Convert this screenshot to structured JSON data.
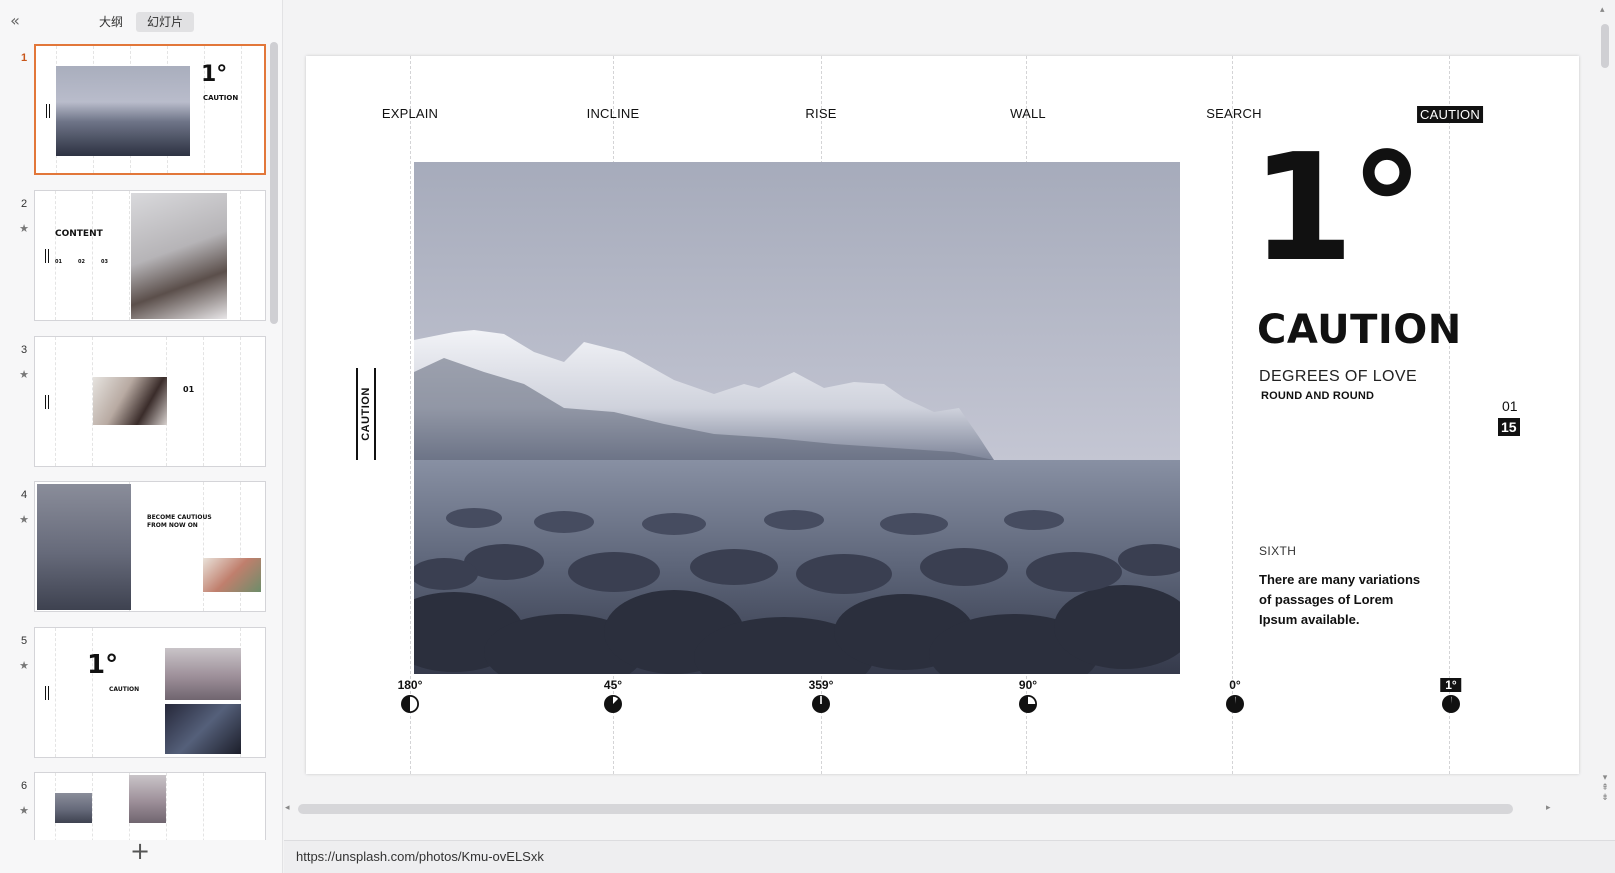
{
  "left_panel": {
    "collapse_icon": "double-chevron-left-icon",
    "tabs": [
      {
        "label": "大纲",
        "active": false
      },
      {
        "label": "幻灯片",
        "active": true
      }
    ],
    "thumbnails": [
      {
        "number": "1",
        "active": true,
        "star": ""
      },
      {
        "number": "2",
        "active": false,
        "star": "★"
      },
      {
        "number": "3",
        "active": false,
        "star": "★"
      },
      {
        "number": "4",
        "active": false,
        "star": "★"
      },
      {
        "number": "5",
        "active": false,
        "star": "★"
      },
      {
        "number": "6",
        "active": false,
        "star": "★"
      }
    ],
    "thumb_text": {
      "t1_degree": "1°",
      "t1_title": "CAUTION",
      "t2_title": "CONTENT",
      "t2_n1": "01",
      "t2_n2": "02",
      "t2_n3": "03",
      "t3_n1": "01",
      "t4_title": "BECOME CAUTIOUS",
      "t4_title2": "FROM NOW ON",
      "t5_degree": "1°",
      "t5_title": "CAUTION"
    },
    "add_button": "+"
  },
  "slide": {
    "nav_items": [
      {
        "label": "EXPLAIN",
        "active": false
      },
      {
        "label": "INCLINE",
        "active": false
      },
      {
        "label": "RISE",
        "active": false
      },
      {
        "label": "WALL",
        "active": false
      },
      {
        "label": "SEARCH",
        "active": false
      },
      {
        "label": "CAUTION",
        "active": true
      }
    ],
    "side_label": "CAUTION",
    "degree_number": "1°",
    "title": "CAUTION",
    "subtitle": "DEGREES OF LOVE",
    "subtitle2": "ROUND AND ROUND",
    "page_current": "01",
    "page_total": "15",
    "section_label": "SIXTH",
    "body_text": "There are many variations of passages of Lorem Ipsum available.",
    "degrees": [
      {
        "label": "180°",
        "value": 180,
        "active": false
      },
      {
        "label": "45°",
        "value": 45,
        "active": false
      },
      {
        "label": "359°",
        "value": 359,
        "active": false
      },
      {
        "label": "90°",
        "value": 90,
        "active": false
      },
      {
        "label": "0°",
        "value": 0,
        "active": false
      },
      {
        "label": "1°",
        "value": 1,
        "active": true
      }
    ],
    "photo_description_icon": "mountain-lake-photo"
  },
  "status_bar": {
    "url": "https://unsplash.com/photos/Kmu-ovELSxk"
  },
  "colors": {
    "accent": "#e2773a",
    "ink": "#111111"
  }
}
